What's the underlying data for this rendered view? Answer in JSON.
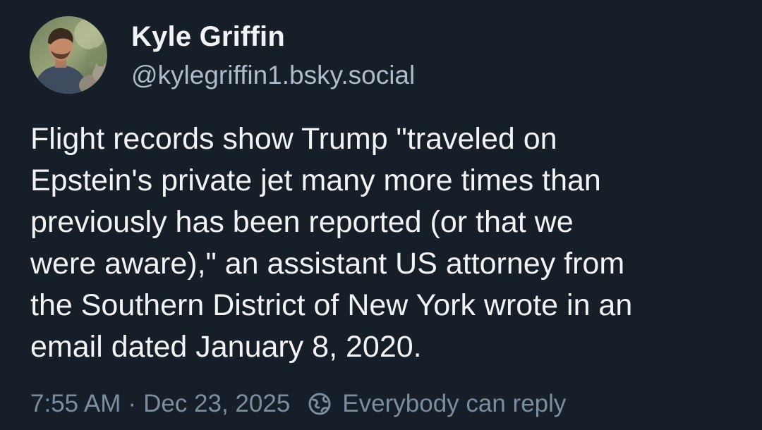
{
  "author": {
    "display_name": "Kyle Griffin",
    "handle": "@kylegriffin1.bsky.social"
  },
  "post": {
    "lines": [
      "Flight records show Trump \"traveled on",
      "Epstein's private jet many more times than",
      "previously has been reported (or that we",
      "were aware),\" an assistant US attorney from",
      "the Southern District of New York wrote in an",
      "email dated January 8, 2020."
    ]
  },
  "meta": {
    "time": "7:55 AM",
    "separator": "·",
    "date": "Dec 23, 2025",
    "reply_setting": "Everybody can reply",
    "reply_icon": "globe-icon"
  },
  "colors": {
    "background": "#161e27",
    "text": "#f1f3f5",
    "secondary": "#aebbc9",
    "muted": "#7b8d9f"
  }
}
